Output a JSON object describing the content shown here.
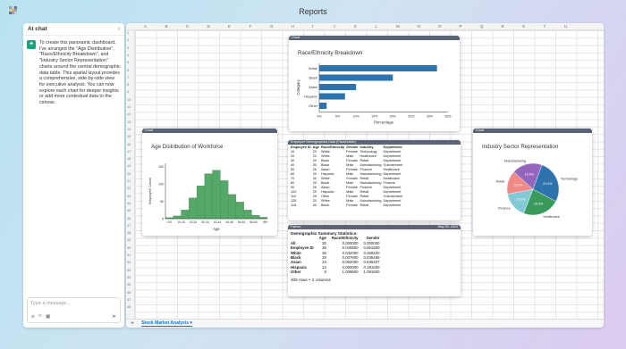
{
  "app": {
    "title": "Reports"
  },
  "chat": {
    "header": "AI chat",
    "collapse_glyph": "‹",
    "message": "To create this panoramic dashboard, I've arranged the \"Age Distribution\", \"Race/Ethnicity Breakdown\", and \"Industry Sector Representation\" charts around the central demographic data table. This spatial layout provides a comprehensive, side-by-side view for executive analysis. You can now explore each chart for deeper insights or add more contextual data to the canvas.",
    "input_placeholder": "Type a message...",
    "icons": [
      "paperclip-icon",
      "link-icon",
      "image-icon",
      "send-icon"
    ]
  },
  "sheet": {
    "columns": [
      "A",
      "B",
      "C",
      "D",
      "E",
      "F",
      "G",
      "H",
      "I",
      "J",
      "K",
      "L",
      "M",
      "N",
      "O",
      "P",
      "Q",
      "R",
      "S",
      "T",
      "U"
    ],
    "rows": [
      "1",
      "2",
      "3",
      "4",
      "5",
      "6",
      "7",
      "8",
      "9",
      "10",
      "11",
      "12",
      "13",
      "14",
      "15",
      "16",
      "17",
      "18",
      "19",
      "20",
      "21",
      "22",
      "23",
      "24",
      "25",
      "26",
      "27",
      "28",
      "29",
      "30",
      "31",
      "32",
      "33",
      "34",
      "35",
      "36",
      "37",
      "38"
    ],
    "tab_add": "+",
    "active_tab": "Stock Market Analysis",
    "tab_caret": "▾"
  },
  "charts": {
    "race_tag": "Chart",
    "age_tag": "Chart",
    "industry_tag": "Chart"
  },
  "table": {
    "tag": "Employee Demographics Data (Placeholder)",
    "headers": [
      "Employee ID",
      "Age",
      "Race/Ethnicity",
      "Gender",
      "Industry",
      "Department"
    ],
    "rows": [
      [
        "10",
        "20",
        "White",
        "Female",
        "Technology",
        "Department"
      ],
      [
        "20",
        "22",
        "White",
        "Male",
        "Healthcare",
        "Department"
      ],
      [
        "30",
        "20",
        "Black",
        "Female",
        "Retail",
        "Department"
      ],
      [
        "40",
        "30",
        "Black",
        "Male",
        "Manufacturing",
        "Gdcnstrment"
      ],
      [
        "50",
        "26",
        "Asian",
        "Female",
        "Finance",
        "Healthcare"
      ],
      [
        "60",
        "20",
        "Hispanic",
        "Male",
        "Manufacturing",
        "Department"
      ],
      [
        "70",
        "30",
        "White",
        "Female",
        "Retail",
        "Healthcare"
      ],
      [
        "80",
        "20",
        "Black",
        "Male",
        "Manufacturing",
        "Finance"
      ],
      [
        "90",
        "26",
        "Asian",
        "Female",
        "Finance",
        "Department"
      ],
      [
        "100",
        "20",
        "Hispanic",
        "Male",
        "Retail",
        "Department"
      ],
      [
        "110",
        "25",
        "Other",
        "Female",
        "Retail",
        "Gdcnstrment"
      ],
      [
        "125",
        "20",
        "White",
        "Male",
        "Manufacturing",
        "Department"
      ],
      [
        "118",
        "30",
        "Black",
        "Female",
        "Retail",
        "Department"
      ]
    ]
  },
  "python": {
    "tag": "Python",
    "timestamp": "May 30, 2024",
    "heading": "Demographic Summary Statistics:",
    "headers": [
      "",
      "Age",
      "Race/Ethnicity",
      "Gender"
    ],
    "rows": [
      [
        "All",
        "30",
        "0.000000",
        "0.000000"
      ],
      [
        "Employee ID",
        "36",
        "0.049500",
        "0.661500"
      ],
      [
        "White",
        "36",
        "0.042000",
        "0.269200"
      ],
      [
        "Black",
        "28",
        "0.037600",
        "0.035499"
      ],
      [
        "Asian",
        "23",
        "0.062000",
        "0.636207"
      ],
      [
        "Hispanic",
        "13",
        "0.000000",
        "0.191500"
      ],
      [
        "Other",
        "8",
        "1.009600",
        "1.091500"
      ]
    ],
    "footer": "309 rows × 2 columns"
  },
  "chart_data": [
    {
      "type": "bar",
      "orientation": "horizontal",
      "title": "Race/Ethnicity Breakdown",
      "xlabel": "Percentage",
      "ylabel": "Category",
      "categories": [
        "White",
        "Black",
        "Asian",
        "Hispanic",
        "Other"
      ],
      "values": [
        32,
        20,
        10,
        7,
        2
      ],
      "xlim": [
        0,
        35
      ],
      "xticks": [
        "0%",
        "5%",
        "10%",
        "15%",
        "20%",
        "25%",
        "30%",
        "35%"
      ],
      "color": "#2d73ad"
    },
    {
      "type": "bar",
      "title": "Age Distribution of Workforce",
      "xlabel": "Age",
      "ylabel": "Employee Count",
      "categories": [
        "<10",
        "10-18",
        "20-24",
        "25-29",
        "30-34",
        "35-39",
        "40-44",
        "45-49",
        "50-54",
        "55-59",
        "60-64",
        "65-69",
        "70+"
      ],
      "values": [
        3,
        8,
        25,
        60,
        95,
        130,
        140,
        110,
        70,
        48,
        25,
        10,
        4
      ],
      "xticks": [
        "<10",
        "10-18",
        "20-24",
        "30-34",
        "40-44",
        "44-48",
        "54-64",
        "56-64",
        "68+"
      ],
      "yticks": [
        "0",
        "50",
        "100",
        "150"
      ],
      "ylim": [
        0,
        160
      ],
      "color": "#55a868"
    },
    {
      "type": "pie",
      "title": "Industry Sector Representation",
      "labels": [
        "Technology",
        "Healthcare",
        "Finance",
        "Retail",
        "Manufacturing"
      ],
      "values": [
        23.0,
        19.5,
        13.6,
        12.5,
        15.9
      ],
      "pct_labels": [
        "23.0%",
        "19.5%",
        "13.6%",
        "12.5%",
        "15.9%"
      ],
      "colors": [
        "#2d73ad",
        "#3a9a5c",
        "#83c9d8",
        "#f08a86",
        "#9467bd"
      ]
    }
  ]
}
